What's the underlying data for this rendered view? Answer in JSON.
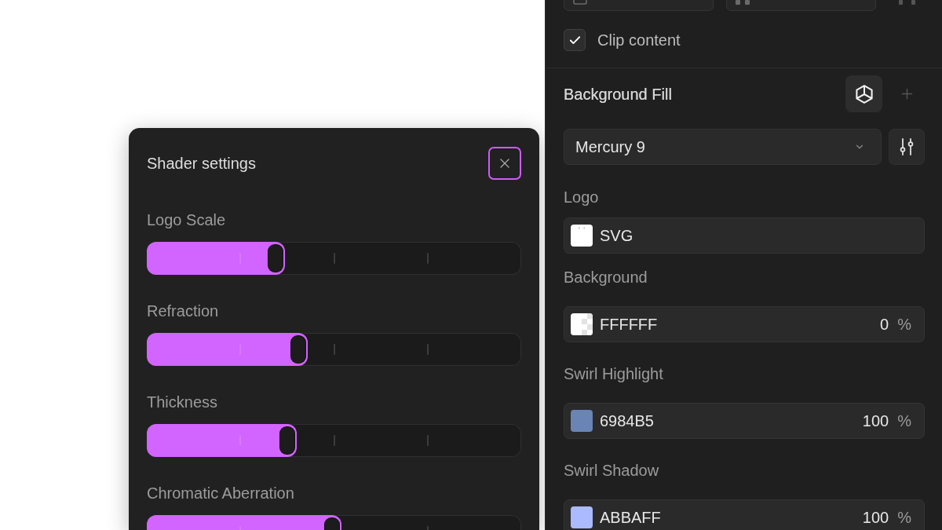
{
  "shader_settings": {
    "title": "Shader settings",
    "close_button": {
      "focused": true
    },
    "sliders": [
      {
        "label": "Logo Scale",
        "level": 0.37
      },
      {
        "label": "Refraction",
        "level": 0.43
      },
      {
        "label": "Thickness",
        "level": 0.4
      },
      {
        "label": "Chromatic Aberration",
        "level": 0.52
      }
    ]
  },
  "properties": {
    "top_row": [
      {
        "kind": "field"
      },
      {
        "kind": "field"
      },
      {
        "kind": "icon"
      }
    ],
    "clip_content": {
      "label": "Clip content",
      "checked": true
    },
    "background_fill": {
      "title": "Background Fill",
      "preset": "Mercury 9",
      "inputs": [
        {
          "kind": "asset",
          "label": "Logo",
          "value": "SVG"
        },
        {
          "kind": "color",
          "label": "Background",
          "value": "FFFFFF",
          "color": "#ffffff",
          "transparent": true,
          "opacity": "0",
          "unit": "%"
        },
        {
          "kind": "color",
          "label": "Swirl Highlight",
          "value": "6984B5",
          "color": "#6984b5",
          "transparent": false,
          "opacity": "100",
          "unit": "%"
        },
        {
          "kind": "color",
          "label": "Swirl Shadow",
          "value": "ABBAFF",
          "color": "#abbaff",
          "transparent": false,
          "opacity": "100",
          "unit": "%"
        }
      ]
    }
  }
}
